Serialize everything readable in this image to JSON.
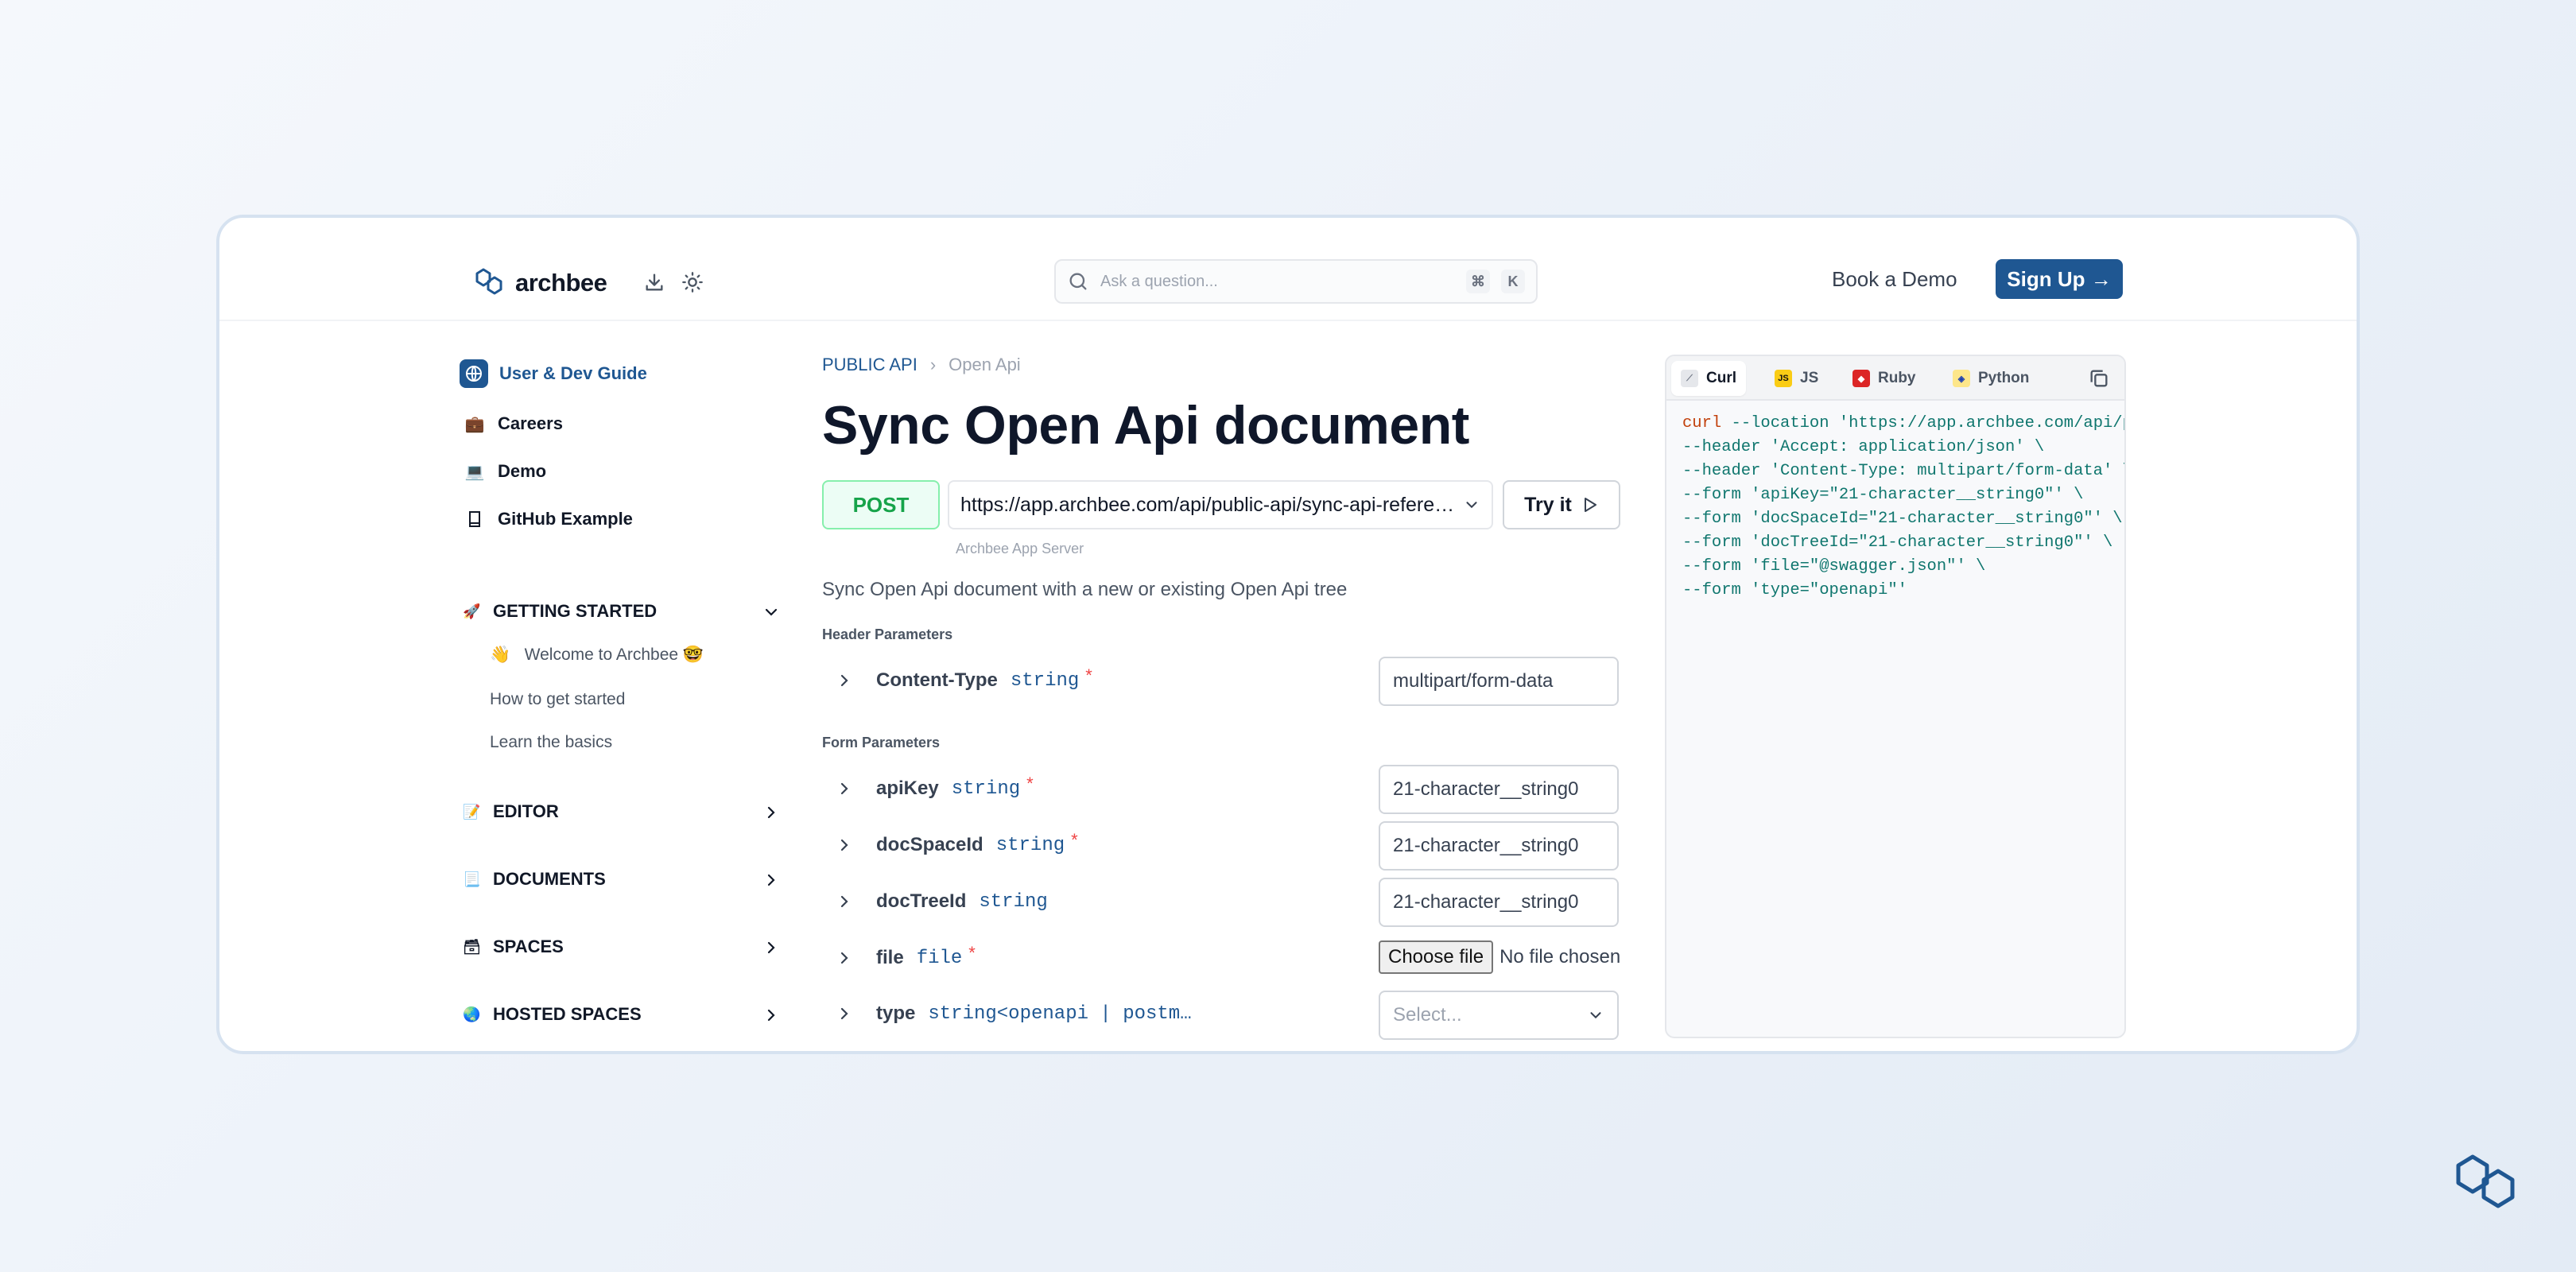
{
  "header": {
    "logo_text": "archbee",
    "search_placeholder": "Ask a question...",
    "search_shortcut": [
      "⌘",
      "K"
    ],
    "book_demo": "Book a Demo",
    "sign_up": "Sign Up →"
  },
  "sidebar": {
    "links": [
      {
        "label": "User & Dev Guide",
        "icon": "globe-icon"
      },
      {
        "label": "Careers",
        "icon": "briefcase-icon"
      },
      {
        "label": "Demo",
        "icon": "computer-icon"
      },
      {
        "label": "GitHub Example",
        "icon": "book-icon"
      }
    ],
    "getting_started": {
      "label": "GETTING STARTED",
      "icon": "🚀",
      "items": [
        "Welcome to Archbee 🤓",
        "How to get started",
        "Learn the basics"
      ],
      "item_icons": [
        "👋"
      ]
    },
    "sections": [
      {
        "label": "EDITOR",
        "icon": "📝"
      },
      {
        "label": "DOCUMENTS",
        "icon": "📃"
      },
      {
        "label": "SPACES",
        "icon": "🗃"
      },
      {
        "label": "HOSTED SPACES",
        "icon": "🌏"
      }
    ]
  },
  "main": {
    "breadcrumb": [
      "PUBLIC API",
      "Open Api"
    ],
    "title": "Sync Open Api document",
    "method": "POST",
    "url": "https://app.archbee.com/api/public-api/sync-api-reference",
    "try_it": "Try it",
    "server": "Archbee App Server",
    "description": "Sync Open Api document with a new or existing Open Api tree",
    "header_params_label": "Header Parameters",
    "header_params": [
      {
        "name": "Content-Type",
        "type": "string",
        "required": "*",
        "value": "multipart/form-data"
      }
    ],
    "form_params_label": "Form Parameters",
    "form_params": [
      {
        "name": "apiKey",
        "type": "string",
        "required": "*",
        "value": "21-character__string0"
      },
      {
        "name": "docSpaceId",
        "type": "string",
        "required": "*",
        "value": "21-character__string0"
      },
      {
        "name": "docTreeId",
        "type": "string",
        "required": "",
        "value": "21-character__string0"
      },
      {
        "name": "file",
        "type": "file",
        "required": "*",
        "file_button": "Choose file",
        "file_status": "No file chosen"
      },
      {
        "name": "type",
        "type": "string<openapi | postm…",
        "required": "",
        "placeholder": "Select..."
      }
    ]
  },
  "code": {
    "tabs": [
      "Curl",
      "JS",
      "Ruby",
      "Python"
    ],
    "active_tab": "Curl",
    "lines": [
      {
        "kw": "curl",
        "rest": " --location 'https://app.archbee.com/api/public-api/sync-api-reference' \\"
      },
      {
        "kw": "",
        "rest": "--header 'Accept: application/json' \\"
      },
      {
        "kw": "",
        "rest": "--header 'Content-Type: multipart/form-data' \\"
      },
      {
        "kw": "",
        "rest": "--form 'apiKey=\"21-character__string0\"' \\"
      },
      {
        "kw": "",
        "rest": "--form 'docSpaceId=\"21-character__string0\"' \\"
      },
      {
        "kw": "",
        "rest": "--form 'docTreeId=\"21-character__string0\"' \\"
      },
      {
        "kw": "",
        "rest": "--form 'file=\"@swagger.json\"' \\"
      },
      {
        "kw": "",
        "rest": "--form 'type=\"openapi\"'"
      }
    ]
  },
  "colors": {
    "brand": "#1f5792",
    "post": "#16a34a",
    "code": "#0f766e",
    "keyword": "#c2410c"
  }
}
